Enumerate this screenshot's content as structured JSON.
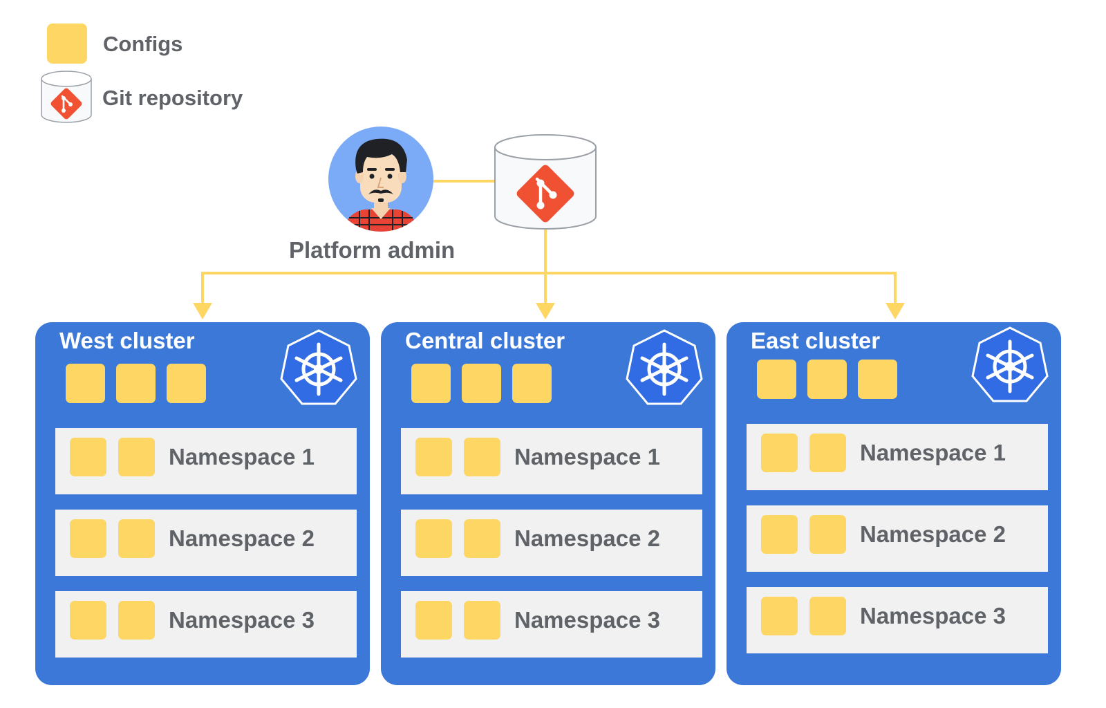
{
  "legend": {
    "configs_label": "Configs",
    "git_label": "Git repository"
  },
  "admin": {
    "label": "Platform admin"
  },
  "colors": {
    "config": "#fdd663",
    "cluster": "#3c78d8",
    "connector": "#fdd663",
    "git": "#f05133"
  },
  "clusters": [
    {
      "title": "West cluster",
      "namespaces": [
        "Namespace 1",
        "Namespace 2",
        "Namespace 3"
      ]
    },
    {
      "title": "Central cluster",
      "namespaces": [
        "Namespace 1",
        "Namespace 2",
        "Namespace 3"
      ]
    },
    {
      "title": "East cluster",
      "namespaces": [
        "Namespace 1",
        "Namespace 2",
        "Namespace 3"
      ]
    }
  ]
}
